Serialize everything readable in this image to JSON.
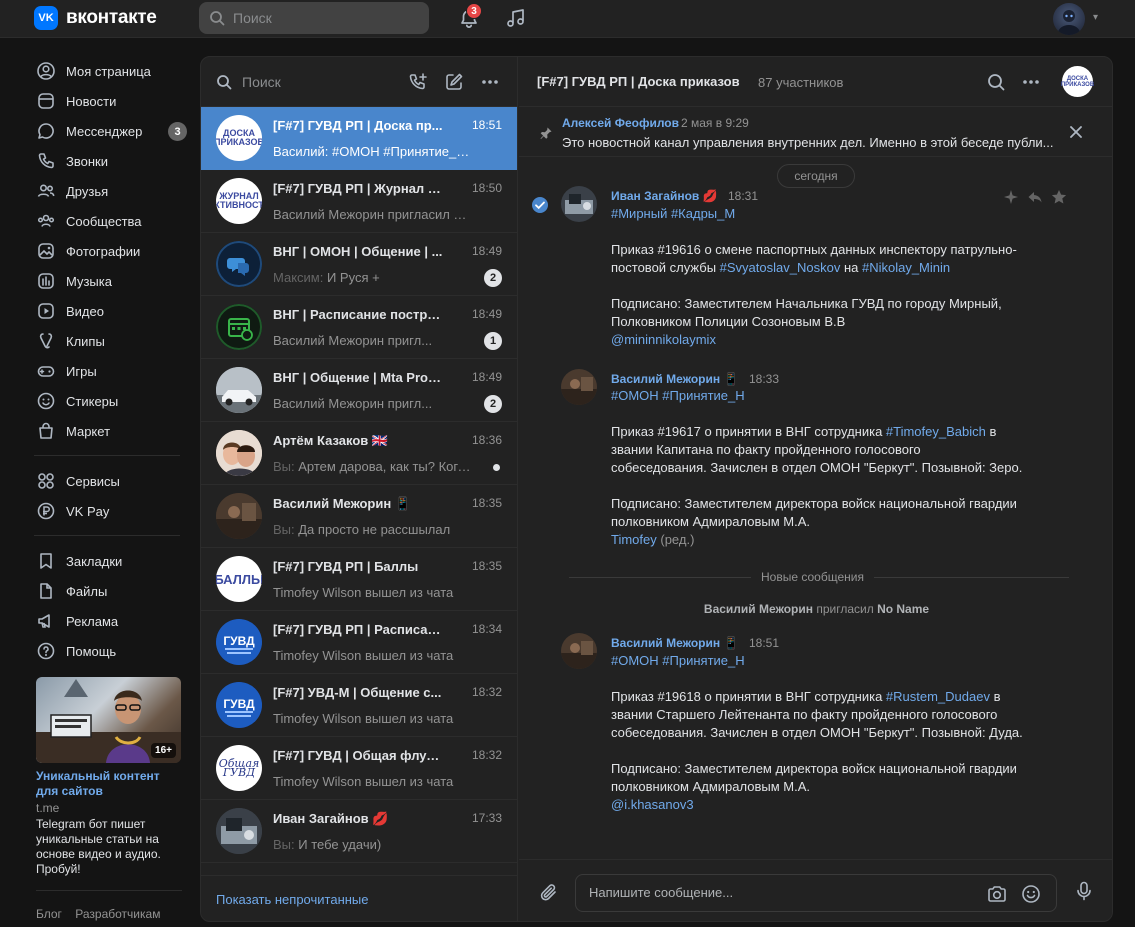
{
  "header": {
    "logo_mark": "VK",
    "logo_text": "вконтакте",
    "search_placeholder": "Поиск",
    "notifications_count": "3"
  },
  "nav": {
    "items": [
      {
        "label": "Моя страница",
        "icon": "user-icon"
      },
      {
        "label": "Новости",
        "icon": "news-icon"
      },
      {
        "label": "Мессенджер",
        "icon": "messenger-icon",
        "badge": "3"
      },
      {
        "label": "Звонки",
        "icon": "phone-icon"
      },
      {
        "label": "Друзья",
        "icon": "friends-icon"
      },
      {
        "label": "Сообщества",
        "icon": "communities-icon"
      },
      {
        "label": "Фотографии",
        "icon": "photos-icon"
      },
      {
        "label": "Музыка",
        "icon": "music-icon"
      },
      {
        "label": "Видео",
        "icon": "video-icon"
      },
      {
        "label": "Клипы",
        "icon": "clips-icon"
      },
      {
        "label": "Игры",
        "icon": "games-icon"
      },
      {
        "label": "Стикеры",
        "icon": "stickers-icon"
      },
      {
        "label": "Маркет",
        "icon": "market-icon"
      }
    ],
    "items2": [
      {
        "label": "Сервисы",
        "icon": "services-icon"
      },
      {
        "label": "VK Pay",
        "icon": "vkpay-icon"
      }
    ],
    "items3": [
      {
        "label": "Закладки",
        "icon": "bookmarks-icon"
      },
      {
        "label": "Файлы",
        "icon": "files-icon"
      },
      {
        "label": "Реклама",
        "icon": "ads-icon"
      },
      {
        "label": "Помощь",
        "icon": "help-icon"
      }
    ]
  },
  "ad": {
    "age": "16+",
    "title": "Уникальный контент для сайтов",
    "source": "t.me",
    "text": "Telegram бот пишет уникальные статьи на основе видео и аудио. Пробуй!"
  },
  "footer": {
    "blog": "Блог",
    "dev": "Разработчикам"
  },
  "list": {
    "search_placeholder": "Поиск",
    "show_unread": "Показать непрочитанные",
    "conversations": [
      {
        "name": "[F#7] ГУВД РП | Доска пр...",
        "time": "18:51",
        "preview_author": "Василий:",
        "preview": " #ОМОН #Принятие_Н Прик...",
        "avatar_text": "ДОСКА ПРИКАЗОВ",
        "active": true
      },
      {
        "name": "[F#7] ГУВД РП | Журнал а...",
        "time": "18:50",
        "preview_author": "",
        "preview": "Василий Межорин пригласил No Name",
        "avatar_text": "ЖУРНАЛ АКТИВНОСТИ"
      },
      {
        "name": "ВНГ | ОМОН | Общение | ...",
        "time": "18:49",
        "preview_author": "Максим:",
        "preview": " И Руся +",
        "avatar_text": "",
        "badge": "2"
      },
      {
        "name": "ВНГ | Расписание постро...",
        "time": "18:49",
        "preview_author": "",
        "preview": "Василий Межорин пригл...",
        "avatar_text": "",
        "badge": "1"
      },
      {
        "name": "ВНГ | Общение | Mta Provi...",
        "time": "18:49",
        "preview_author": "",
        "preview": "Василий Межорин пригл...",
        "avatar_text": "",
        "badge": "2"
      },
      {
        "name": "Артём Казаков 🇬🇧",
        "time": "18:36",
        "preview_author": "Вы:",
        "preview": " Артем дарова, как ты? Когда в...",
        "avatar_text": "",
        "dot": true
      },
      {
        "name": "Василий Межорин 📱",
        "time": "18:35",
        "preview_author": "Вы:",
        "preview": " Да просто не рассшылал",
        "avatar_text": ""
      },
      {
        "name": "[F#7] ГУВД РП | Баллы",
        "time": "18:35",
        "preview_author": "",
        "preview": "Timofey Wilson вышел из чата",
        "avatar_text": "БАЛЛЫ"
      },
      {
        "name": "[F#7] ГУВД РП | Расписан...",
        "time": "18:34",
        "preview_author": "",
        "preview": "Timofey Wilson вышел из чата",
        "avatar_text": "ГУВД"
      },
      {
        "name": "[F#7] УВД-М | Общение с...",
        "time": "18:32",
        "preview_author": "",
        "preview": "Timofey Wilson вышел из чата",
        "avatar_text": "ГУВД"
      },
      {
        "name": "[F#7] ГУВД | Общая флуд...",
        "time": "18:32",
        "preview_author": "",
        "preview": "Timofey Wilson вышел из чата",
        "avatar_text": "Общая ГУВД"
      },
      {
        "name": "Иван Загайнов 💋",
        "time": "17:33",
        "preview_author": "Вы:",
        "preview": " И тебе удачи)",
        "avatar_text": ""
      }
    ]
  },
  "conversation": {
    "title": "[F#7] ГУВД РП | Доска приказов",
    "members": "87 участников",
    "avatar_text": "ДОСКА ПРИКАЗОВ",
    "pinned": {
      "author": "Алексей Феофилов",
      "date": "2 мая в 9:29",
      "text": "Это новостной канал управления внутренних дел. Именно в этой беседе публи..."
    },
    "today_label": "сегодня",
    "new_messages_label": "Новые сообщения",
    "system_message": {
      "actor": "Василий Межорин",
      "action": " пригласил ",
      "target": "No Name"
    },
    "msg1": {
      "author": "Иван Загайнов 💋",
      "time": "18:31",
      "tags": "#Мирный #Кадры_М",
      "l1": "Приказ #19616 о смене паспортных данных инспектору патрульно-",
      "l2a": "постовой службы ",
      "l2b": "#Svyatoslav_Noskov",
      "l2c": " на ",
      "l2d": "#Nikolay_Minin",
      "l3": "Подписано: Заместителем Начальника ГУВД по городу Мирный,",
      "l4": "Полковником Полиции Созоновым В.В",
      "l5": "@mininnikolaymix"
    },
    "msg2": {
      "author": "Василий Межорин 📱",
      "time": "18:33",
      "tags": "#ОМОН #Принятие_Н",
      "l1a": "Приказ #19617 о принятии в ВНГ сотрудника ",
      "l1b": "#Timofey_Babich",
      "l1c": " в",
      "l2": "звании Капитана по факту пройденного голосового",
      "l3": "собеседования. Зачислен в отдел ОМОН \"Беркут\". Позывной: Зеро.",
      "l4": "Подписано: Заместителем директора войск национальной гвардии",
      "l5": "полковником Адмираловым М.А.",
      "l6a": "Timofey",
      "l6b": " (ред.)"
    },
    "msg3": {
      "author": "Василий Межорин 📱",
      "time": "18:51",
      "tags": "#ОМОН #Принятие_Н",
      "l1a": "Приказ #19618 о принятии в ВНГ сотрудника ",
      "l1b": "#Rustem_Dudaev",
      "l1c": " в",
      "l2": "звании Старшего Лейтенанта по факту пройденного голосового",
      "l3": "собеседования. Зачислен в отдел ОМОН \"Беркут\". Позывной: Дуда.",
      "l4": "Подписано: Заместителем директора войск национальной гвардии",
      "l5": "полковником Адмираловым М.А.",
      "l6": "@i.khasanov3"
    },
    "compose_placeholder": "Напишите сообщение..."
  },
  "colors": {
    "accent": "#71aaeb",
    "active": "#4986cc",
    "badge_red": "#e64646",
    "background": "#141414",
    "panel": "#222222"
  }
}
